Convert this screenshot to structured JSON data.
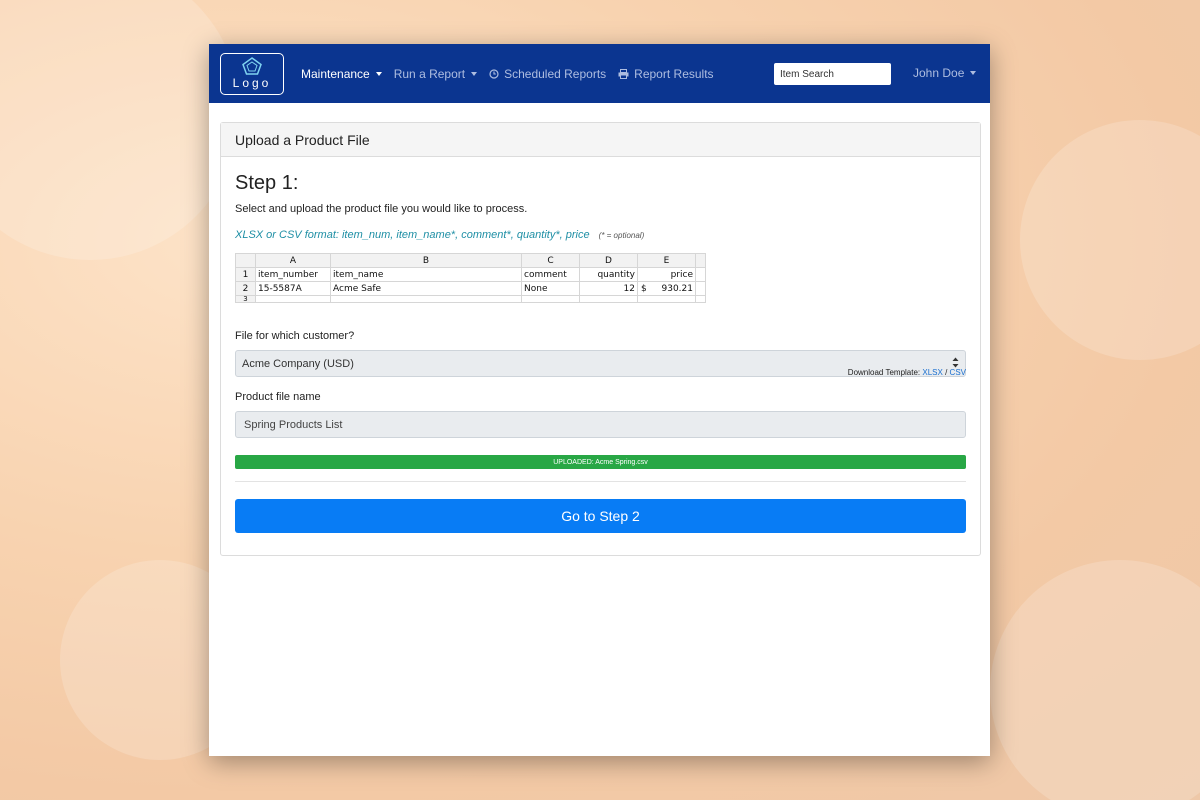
{
  "navbar": {
    "logo_text": "Logo",
    "items": [
      {
        "label": "Maintenance",
        "icon": "",
        "active": true,
        "dropdown": true
      },
      {
        "label": "Run a Report",
        "icon": "",
        "active": false,
        "dropdown": true
      },
      {
        "label": "Scheduled Reports",
        "icon": "clock-icon",
        "active": false,
        "dropdown": false
      },
      {
        "label": "Report Results",
        "icon": "printer-icon",
        "active": false,
        "dropdown": false
      }
    ],
    "search_placeholder": "Item Search",
    "user_name": "John Doe",
    "colors": {
      "background": "#0b3590",
      "active_text": "#ffffff",
      "inactive_text": "#aebde0"
    }
  },
  "card": {
    "header": "Upload a Product File",
    "step_title": "Step 1:",
    "step_desc": "Select and upload the product file you would like to process.",
    "format_text": "XLSX or CSV format: item_num, item_name*, comment*, quantity*, price",
    "optional_note": "(* = optional)",
    "sheet": {
      "columns": [
        "A",
        "B",
        "C",
        "D",
        "E"
      ],
      "rows": [
        {
          "num": "1",
          "cells": [
            "item_number",
            "item_name",
            "comment",
            "quantity",
            "price"
          ]
        },
        {
          "num": "2",
          "cells": [
            "15-5587A",
            "Acme Safe",
            "None",
            "12",
            "$",
            "930.21"
          ]
        },
        {
          "num": "3",
          "cells": [
            "",
            "",
            "",
            "",
            ""
          ]
        }
      ]
    },
    "download_label": "Download Template:",
    "download_xlsx": "XLSX",
    "download_sep": "/",
    "download_csv": "CSV",
    "customer_label": "File for which customer?",
    "customer_value": "Acme Company (USD)",
    "filename_label": "Product file name",
    "filename_value": "Spring Products List",
    "upload_status": "UPLOADED: Acme Spring.csv",
    "upload_progress": 1.0,
    "button_label": "Go to Step 2",
    "colors": {
      "accent": "#087cf5",
      "success": "#28a745",
      "format_text": "#1f8fa5"
    }
  }
}
